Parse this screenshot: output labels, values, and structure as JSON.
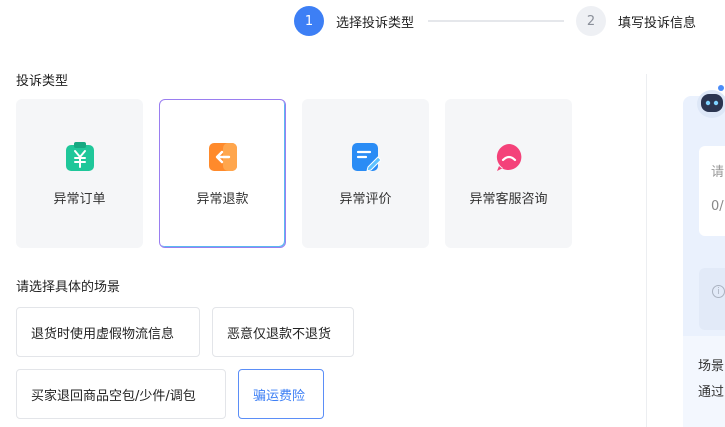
{
  "stepper": {
    "steps": [
      {
        "number": "1",
        "label": "选择投诉类型",
        "state": "active"
      },
      {
        "number": "2",
        "label": "填写投诉信息",
        "state": "inactive"
      }
    ]
  },
  "complaint_type": {
    "title": "投诉类型",
    "cards": [
      {
        "label": "异常订单",
        "icon": "order-icon",
        "color": "#1fc79a"
      },
      {
        "label": "异常退款",
        "icon": "refund-icon",
        "color": "#ff8a2b",
        "selected": true
      },
      {
        "label": "异常评价",
        "icon": "review-icon",
        "color": "#2a8cf5"
      },
      {
        "label": "异常客服咨询",
        "icon": "chat-bubble-icon",
        "color": "#f4427a"
      }
    ]
  },
  "scenario": {
    "title": "请选择具体的场景",
    "row1": [
      {
        "label": "退货时使用虚假物流信息"
      },
      {
        "label": "恶意仅退款不退货"
      }
    ],
    "row2": [
      {
        "label": "买家退回商品空包/少件/调包"
      },
      {
        "label": "骗运费险",
        "selected": true
      }
    ]
  },
  "side_panel": {
    "input_placeholder": "请",
    "counter": "0/",
    "info_icon": "info-icon",
    "text_line1": "场景",
    "text_line2": "通过"
  },
  "colors": {
    "accent": "#3d7ff5",
    "selected_card_border": "#9a7ef0"
  }
}
